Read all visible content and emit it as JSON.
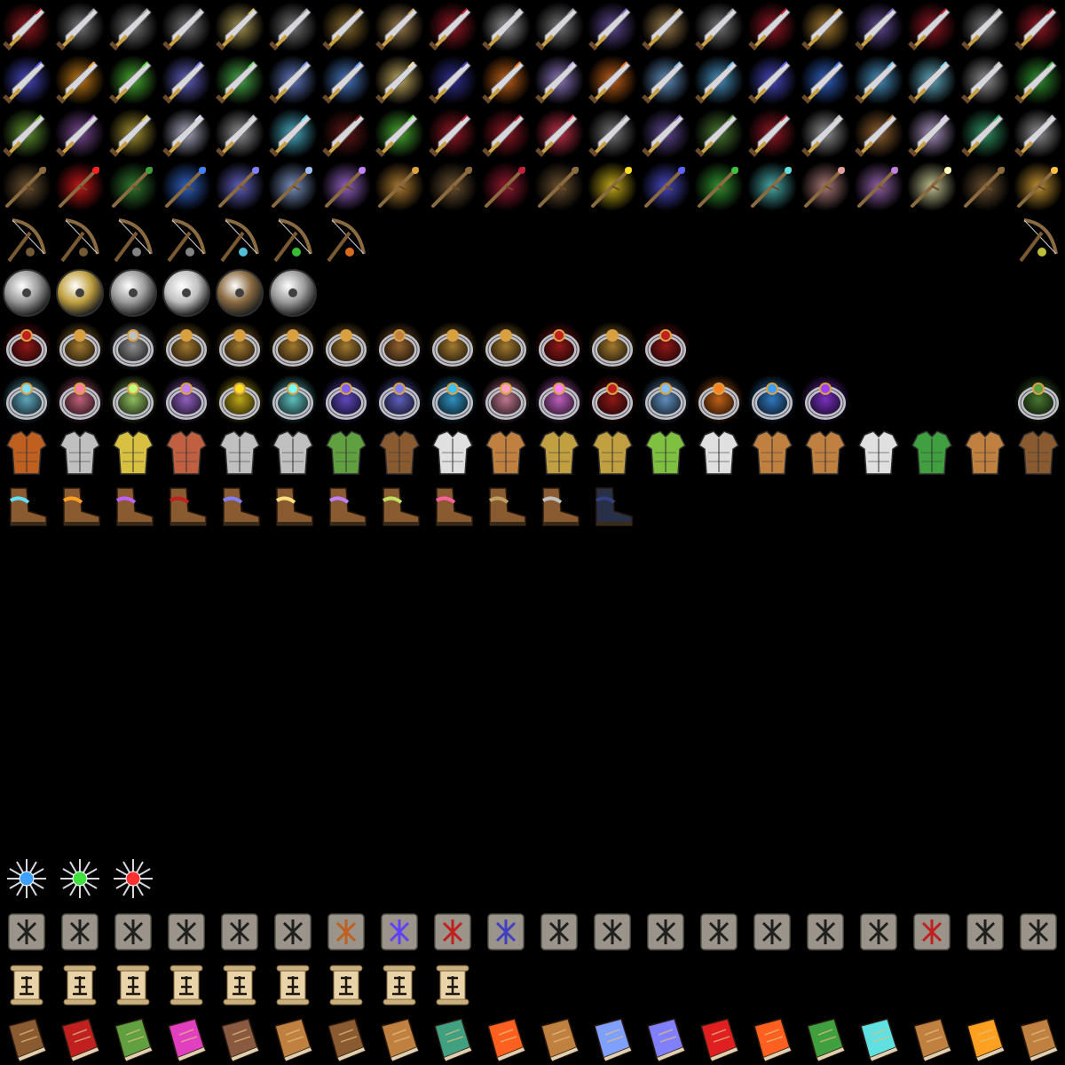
{
  "sheet": {
    "columns": 20,
    "background": "#000000",
    "rows": [
      {
        "name": "daggers-plain",
        "icon": "dagger",
        "slots": [
          0,
          1,
          2,
          3,
          4,
          5,
          6,
          7,
          8,
          9,
          10,
          11,
          12,
          13,
          14,
          15,
          16,
          17,
          18,
          19
        ],
        "effects": [
          "#c0202a",
          "#9a9a9a",
          "#9a9a9a",
          "#9a9a9a",
          "#d8c26a",
          "#9a9a9a",
          "#b08a3a",
          "#c8a060",
          "#c02030",
          "#c0c0c0",
          "#9a9a9a",
          "#8060c0",
          "#c8a060",
          "#9a9a9a",
          "#c02030",
          "#d8a040",
          "#8060c0",
          "#c02030",
          "#9a9a9a",
          "#c02030"
        ]
      },
      {
        "name": "daggers-enchanted",
        "icon": "dagger",
        "slots": [
          0,
          1,
          2,
          3,
          4,
          5,
          6,
          7,
          8,
          9,
          10,
          11,
          12,
          13,
          14,
          15,
          16,
          17,
          18,
          19
        ],
        "effects": [
          "#6060ff",
          "#ffa020",
          "#60e040",
          "#8080ff",
          "#60e060",
          "#80a0ff",
          "#60a0ff",
          "#ffe080",
          "#4040c0",
          "#ff8020",
          "#c0a0ff",
          "#ff8020",
          "#80c0ff",
          "#60c0ff",
          "#6060ff",
          "#4080ff",
          "#60c0ff",
          "#80e0ff",
          "#c0c0c0",
          "#40c040"
        ]
      },
      {
        "name": "daggers-rare",
        "icon": "dagger",
        "slots": [
          0,
          1,
          2,
          3,
          4,
          5,
          6,
          7,
          8,
          9,
          10,
          11,
          12,
          13,
          14,
          15,
          16,
          17,
          18,
          19
        ],
        "effects": [
          "#80c040",
          "#a060c0",
          "#d8c040",
          "#e0e0ff",
          "#c0c0c0",
          "#60e0ff",
          "#802020",
          "#60e040",
          "#c02030",
          "#c02030",
          "#ff4060",
          "#9a9a9a",
          "#8060c0",
          "#60a040",
          "#c02030",
          "#c0c0c0",
          "#c08040",
          "#e0c0ff",
          "#40c080",
          "#c0c0c0"
        ]
      },
      {
        "name": "wands",
        "icon": "wand",
        "slots": [
          0,
          1,
          2,
          3,
          4,
          5,
          6,
          7,
          8,
          9,
          10,
          11,
          12,
          13,
          14,
          15,
          16,
          17,
          18,
          19
        ],
        "effects": [
          "#8a6a40",
          "#ff2020",
          "#40a040",
          "#4080ff",
          "#8080ff",
          "#a0c0ff",
          "#c080ff",
          "#e0a040",
          "#8a6a40",
          "#c02040",
          "#8a6a40",
          "#ffe020",
          "#6060ff",
          "#40c040",
          "#60e0e0",
          "#e0a0a0",
          "#c080e0",
          "#ffffc0",
          "#8a6a40",
          "#ffc040"
        ]
      },
      {
        "name": "slingshots-bows",
        "icon": "bow",
        "slots": [
          0,
          1,
          2,
          3,
          4,
          5,
          6,
          19
        ],
        "effects": [
          "#8a6a40",
          "#8a6a40",
          "#9a9a9a",
          "#9a9a9a",
          "#60e0ff",
          "#40e040",
          "#ff8020",
          "#e0e040"
        ]
      },
      {
        "name": "shields",
        "icon": "shield",
        "slots": [
          0,
          1,
          2,
          3,
          4,
          5
        ],
        "effects": [
          "#9a9a9a",
          "#c0a040",
          "#9a9a9a",
          "#c0c0c0",
          "#8a6a40",
          "#9a9a9a"
        ]
      },
      {
        "name": "rings-gold",
        "icon": "ring",
        "slots": [
          0,
          1,
          2,
          3,
          4,
          5,
          6,
          7,
          8,
          9,
          10,
          11,
          12
        ],
        "effects": [
          "#c02020",
          "#d8a040",
          "#c0c0c0",
          "#d8a040",
          "#d8a040",
          "#d8a040",
          "#d8a040",
          "#c08040",
          "#d8a040",
          "#d8a040",
          "#c02020",
          "#d8a040",
          "#c02020"
        ]
      },
      {
        "name": "rings-magic",
        "icon": "ring",
        "slots": [
          0,
          1,
          2,
          3,
          4,
          5,
          6,
          7,
          8,
          9,
          10,
          11,
          12,
          13,
          14,
          15,
          19
        ],
        "effects": [
          "#80e0ff",
          "#ff80a0",
          "#c0ff80",
          "#c080ff",
          "#ffe020",
          "#80ffff",
          "#8060ff",
          "#8080ff",
          "#40c0ff",
          "#ffa0c0",
          "#ff80ff",
          "#c02020",
          "#80c0ff",
          "#ff8020",
          "#40a0ff",
          "#a040ff",
          "#60a040"
        ]
      },
      {
        "name": "armor",
        "icon": "armor",
        "slots": [
          0,
          1,
          2,
          3,
          4,
          5,
          6,
          7,
          8,
          9,
          10,
          11,
          12,
          13,
          14,
          15,
          16,
          17,
          18,
          19
        ],
        "effects": [
          "#c06020",
          "#c0c0c0",
          "#d8c040",
          "#c06040",
          "#c0c0c0",
          "#c0c0c0",
          "#60a040",
          "#8a5a30",
          "#e0e0e0",
          "#c08040",
          "#c0a040",
          "#c0a040",
          "#80c040",
          "#e0e0e0",
          "#c08040",
          "#c08040",
          "#e0e0e0",
          "#40a040",
          "#c08040",
          "#8a5a30"
        ]
      },
      {
        "name": "boots",
        "icon": "boot",
        "slots": [
          0,
          1,
          2,
          3,
          4,
          5,
          6,
          7,
          8,
          9,
          10,
          11
        ],
        "effects": [
          "#60e0ff",
          "#ffa020",
          "#c060ff",
          "#c02020",
          "#8080ff",
          "#ffe080",
          "#c080ff",
          "#c0e060",
          "#ff60a0",
          "#c0a060",
          "#c0c0c0",
          "#40e040"
        ]
      },
      {
        "name": "boots-dark",
        "icon": "boot-dark",
        "slots": [
          11
        ],
        "effects": [
          "#304080"
        ]
      },
      {
        "name": "stars",
        "icon": "snowflake-gem",
        "row": 16,
        "slots": [
          0,
          1,
          2
        ],
        "effects": [
          "#40a0ff",
          "#40e040",
          "#ff3030"
        ]
      },
      {
        "name": "rune-stones",
        "icon": "rune-stone",
        "row": 17,
        "slots": [
          0,
          1,
          2,
          3,
          4,
          5,
          6,
          7,
          8,
          9,
          10,
          11,
          12,
          13,
          14,
          15,
          16,
          17,
          18,
          19
        ],
        "effects": [
          "#202020",
          "#202020",
          "#202020",
          "#202020",
          "#202020",
          "#202020",
          "#c06020",
          "#6040ff",
          "#c02020",
          "#4040c0",
          "#202020",
          "#202020",
          "#202020",
          "#202020",
          "#202020",
          "#202020",
          "#202020",
          "#c02020",
          "#202020",
          "#202020"
        ]
      },
      {
        "name": "scrolls",
        "icon": "scroll",
        "row": 18,
        "slots": [
          0,
          1,
          2,
          3,
          4,
          5,
          6,
          7,
          8
        ],
        "effects": [
          "#201810",
          "#201810",
          "#201810",
          "#201810",
          "#201810",
          "#201810",
          "#201810",
          "#201810",
          "#201810"
        ]
      },
      {
        "name": "spell-books",
        "icon": "book",
        "row": 19,
        "slots": [
          0,
          1,
          2,
          3,
          4,
          5,
          6,
          7,
          8,
          9,
          10,
          11,
          12,
          13,
          14,
          15,
          16,
          17,
          18,
          19
        ],
        "effects": [
          "#8a5a30",
          "#c02020",
          "#60a040",
          "#e040c0",
          "#8a5a40",
          "#c08040",
          "#8a5a30",
          "#c08040",
          "#40a080",
          "#ff6020",
          "#c08040",
          "#80a0ff",
          "#8080ff",
          "#e02020",
          "#ff6020",
          "#40a040",
          "#60e0e0",
          "#c08040",
          "#ffa020",
          "#c08040"
        ]
      }
    ]
  }
}
